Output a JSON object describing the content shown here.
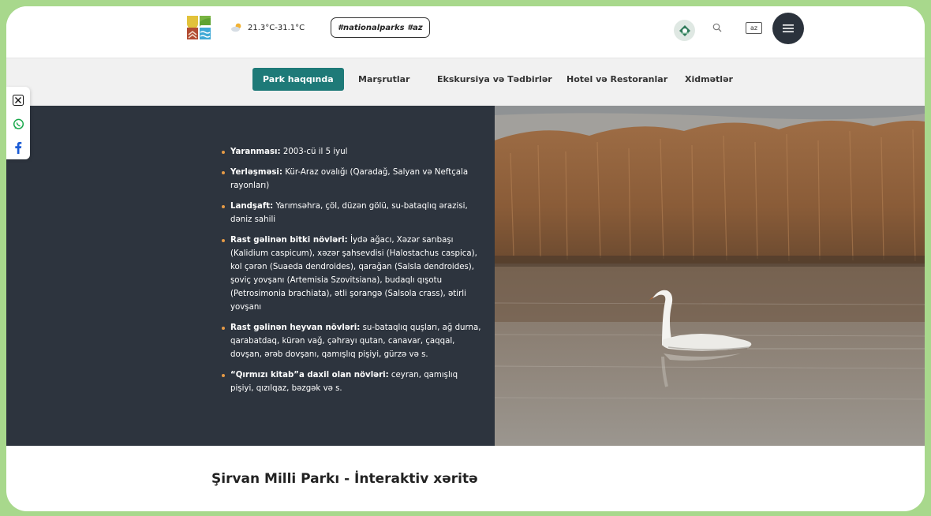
{
  "header": {
    "weather": "21.3°C-31.1°C",
    "hashtag": "#nationalparks #az",
    "lang": "az"
  },
  "nav": {
    "items": [
      {
        "label": "Park haqqında",
        "active": true
      },
      {
        "label": "Marşrutlar"
      },
      {
        "label": "Ekskursiya və Tədbirlər"
      },
      {
        "label": "Hotel və Restoranlar"
      },
      {
        "label": "Xidmətlər"
      }
    ]
  },
  "share": {
    "icons": [
      "x-icon",
      "whatsapp-icon",
      "facebook-icon"
    ]
  },
  "facts": [
    {
      "key": "Yaranması:",
      "text": " 2003-cü il 5 iyul"
    },
    {
      "key": "Yerləşməsi:",
      "text": " Kür-Araz ovalığı (Qaradağ, Salyan və Neftçala  rayonları)"
    },
    {
      "key": "Landşaft:",
      "text": " Yarımsəhra, çöl, düzən gölü, su-bataqlıq ərazisi, dəniz sahili"
    },
    {
      "key": "Rast gəlinən bitki növləri:",
      "text": " İydə ağacı, Xəzər sarıbaşı (Kalidium caspicum), xəzər şahsevdisi (Halostachus caspica), kol çərən (Suaeda dendroides), qarağan (Salsla dendroides), şoviç yovşanı (Artemisia Szovitsiana), budaqlı qışotu (Petrosimonia brachiata), ətli şorangə (Salsola crass), ətirli yovşanı"
    },
    {
      "key": "Rast gəlinən heyvan növləri:",
      "text": " su-bataqlıq quşları, ağ durna, qarabatdaq, kürən vağ, çəhrayı qutan, canavar, çaqqal, dovşan, ərəb dovşanı, qamışlıq pişiyi, gürzə və s."
    },
    {
      "key": "“Qırmızı kitab”a daxil olan növləri:",
      "text": " ceyran, qamışlıq pişiyi, qızılqaz, bəzgək və s."
    }
  ],
  "map": {
    "heading": "Şirvan Milli Parkı - İnteraktiv xəritə"
  },
  "colors": {
    "accent": "#1e7a78",
    "panel": "#2d343e",
    "bullet": "#e59a46",
    "frame": "#a8d88c"
  }
}
